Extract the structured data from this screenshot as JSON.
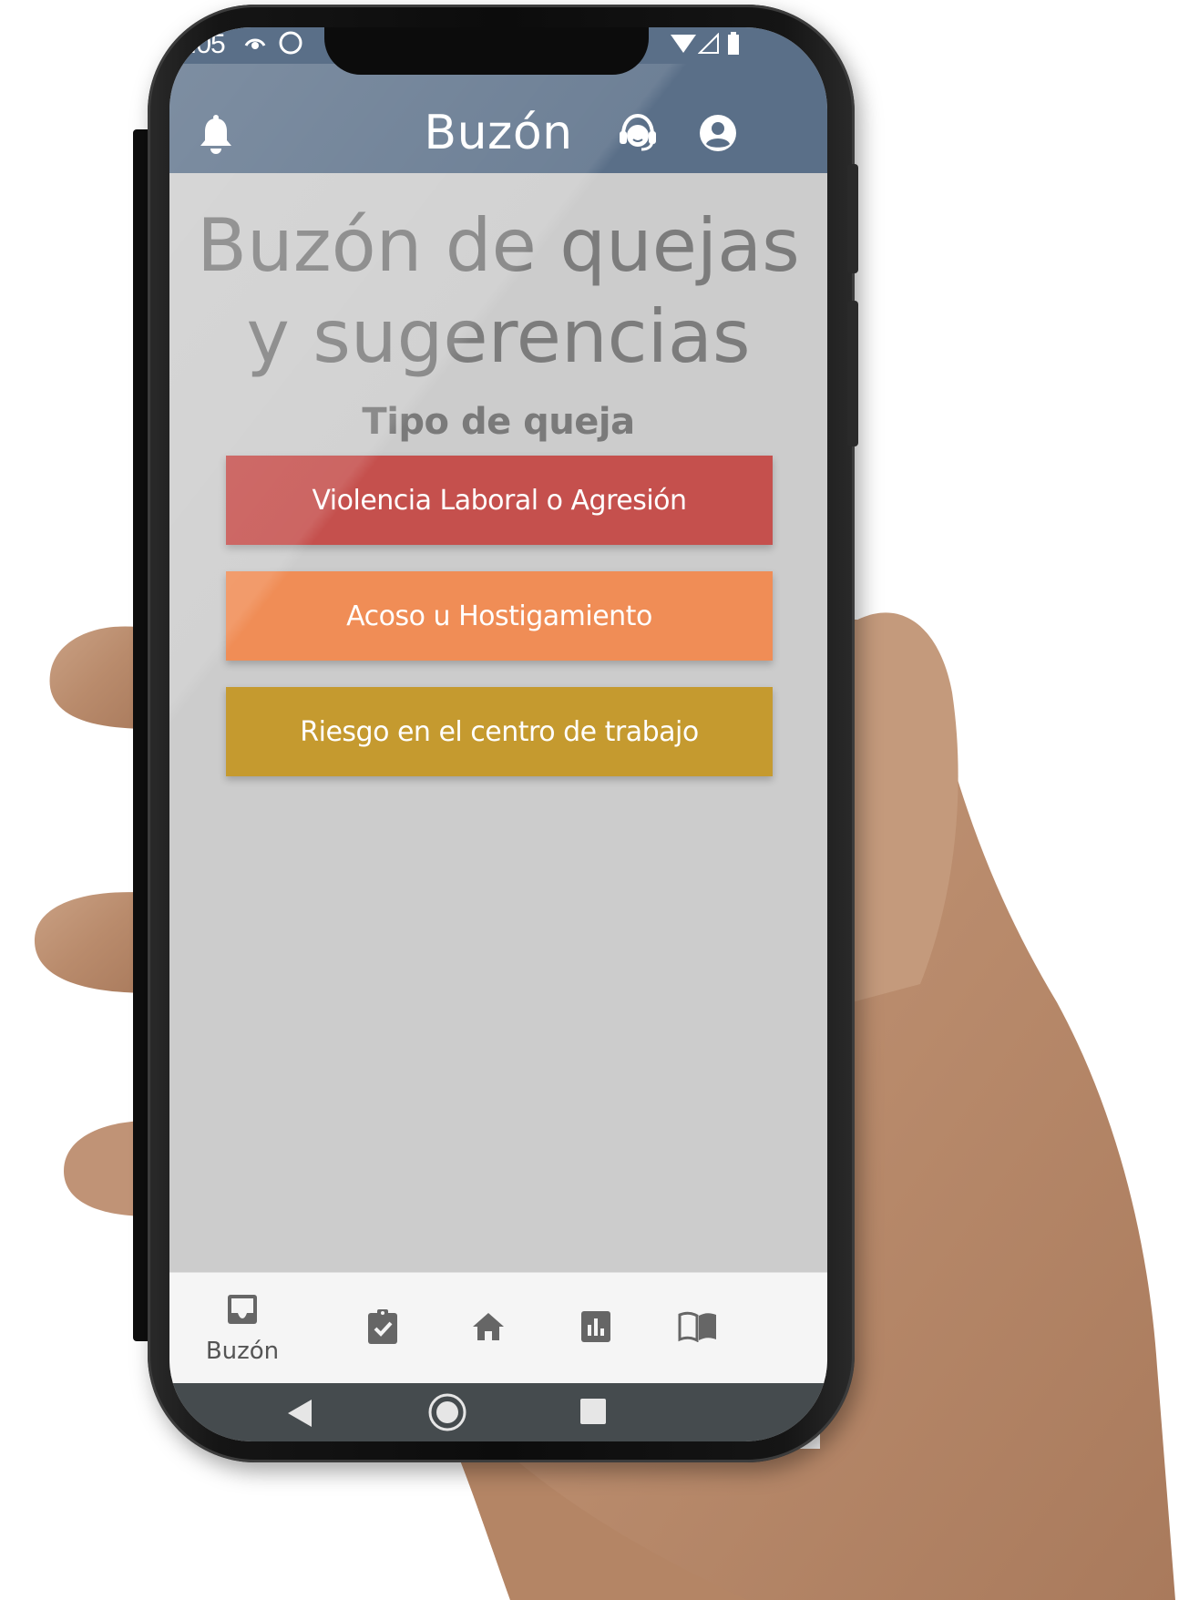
{
  "status_bar": {
    "time": ":05",
    "icons": [
      "eye-icon",
      "loading-ring-icon",
      "wifi-icon",
      "signal-icon",
      "battery-icon"
    ]
  },
  "app_bar": {
    "title": "Buzón",
    "icons": [
      "bell-icon",
      "support-agent-icon",
      "account-circle-icon"
    ]
  },
  "main": {
    "title": "Buzón de quejas y sugerencias",
    "subtitle": "Tipo de queja",
    "options": [
      {
        "label": "Violencia Laboral o Agresión",
        "color": "#c5504d"
      },
      {
        "label": "Acoso u Hostigamiento",
        "color": "#f08d56"
      },
      {
        "label": "Riesgo en el centro de trabajo",
        "color": "#c59a2f"
      }
    ]
  },
  "bottom_nav": {
    "items": [
      {
        "icon": "inbox-icon",
        "label": "Buzón",
        "active": true
      },
      {
        "icon": "clipboard-check-icon",
        "label": ""
      },
      {
        "icon": "home-icon",
        "label": ""
      },
      {
        "icon": "bar-chart-icon",
        "label": ""
      },
      {
        "icon": "book-icon",
        "label": ""
      }
    ]
  },
  "system_nav": [
    "back-icon",
    "home-circle-icon",
    "recents-icon"
  ],
  "colors": {
    "app_bar": "#5a6f88",
    "background": "#cccccc",
    "system_nav": "#454b4e"
  }
}
